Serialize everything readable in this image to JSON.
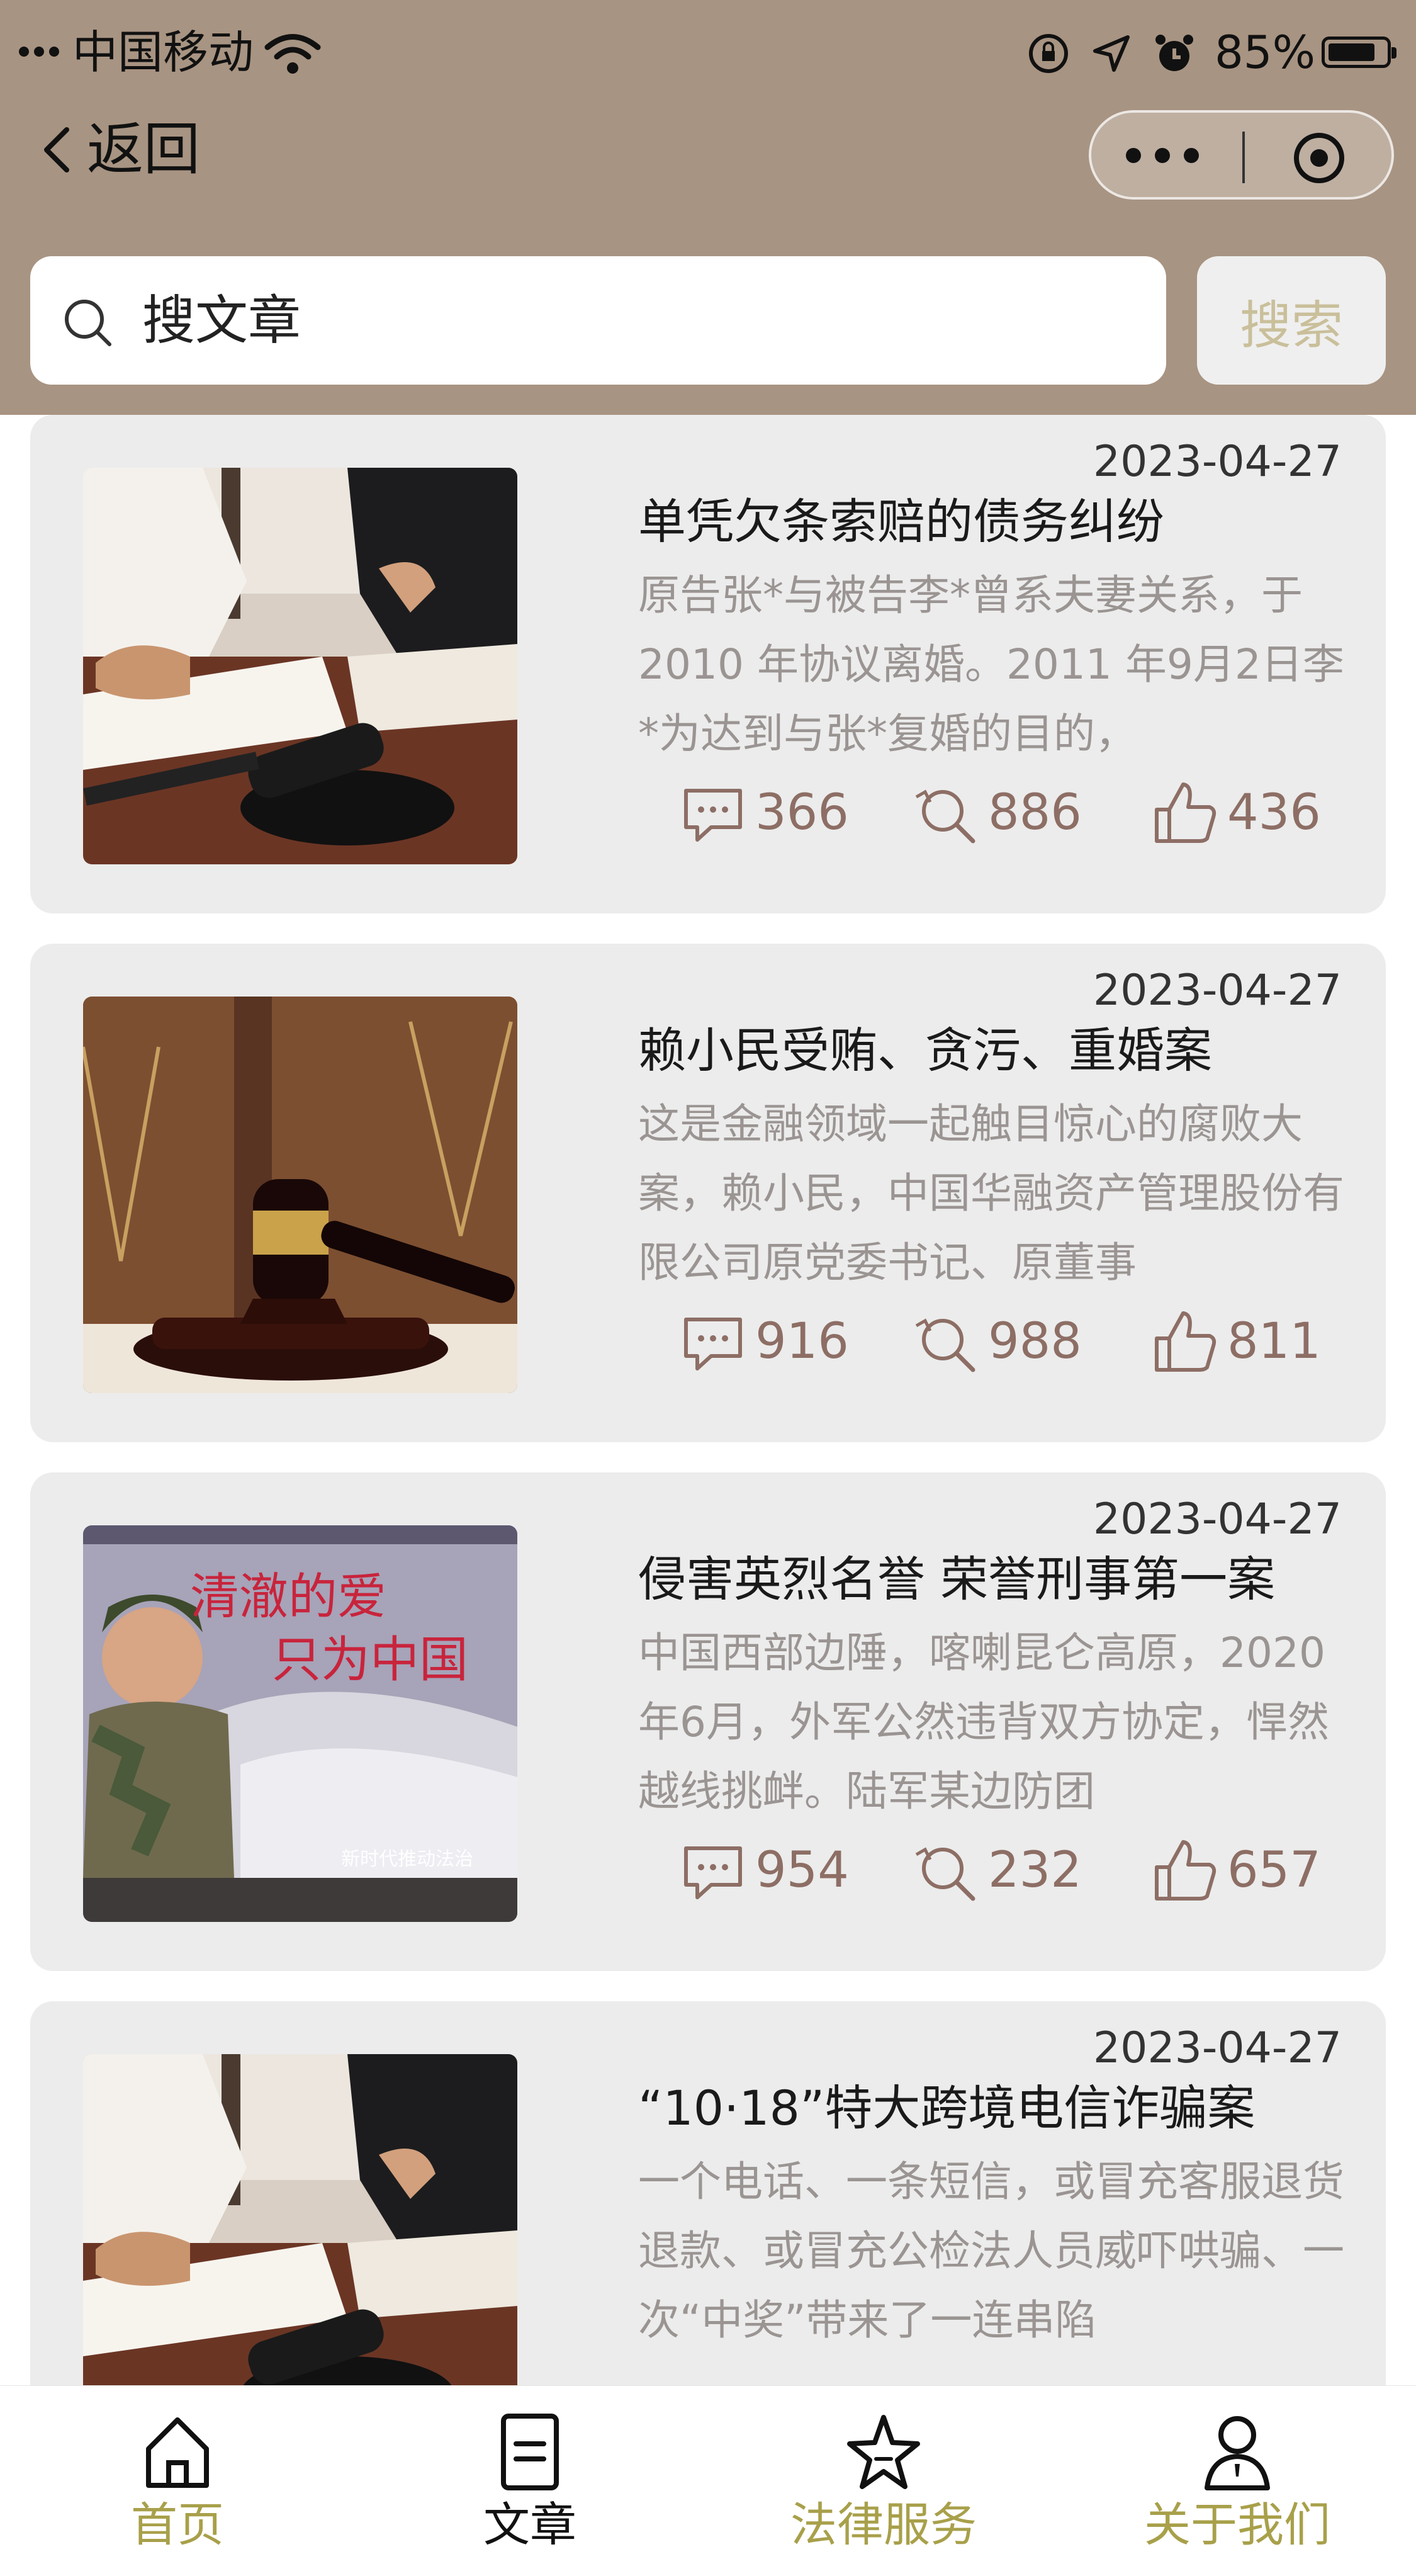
{
  "status_bar": {
    "carrier": "中国移动",
    "battery": "85%",
    "battery_level": 0.85
  },
  "nav": {
    "back_label": "返回"
  },
  "search": {
    "placeholder": "搜文章",
    "button_label": "搜索"
  },
  "articles": [
    {
      "date": "2023-04-27",
      "title": "单凭欠条索赔的债务纠纷",
      "desc": "原告张*与被告李*曾系夫妻关系，于 2010 年协议离婚。2011 年9月2日李*为达到与张*复婚的目的，",
      "comments": "366",
      "views": "886",
      "likes": "436",
      "image": "lawyer-gavel-desk"
    },
    {
      "date": "2023-04-27",
      "title": "赖小民受贿、贪污、重婚案",
      "desc": "这是金融领域一起触目惊心的腐败大案，赖小民，中国华融资产管理股份有限公司原党委书记、原董事",
      "comments": "916",
      "views": "988",
      "likes": "811",
      "image": "gavel-scales"
    },
    {
      "date": "2023-04-27",
      "title": "侵害英烈名誉 荣誉刑事第一案",
      "desc": "中国西部边陲，喀喇昆仑高原，2020年6月，外军公然违背双方协定，悍然越线挑衅。陆军某边防团",
      "comments": "954",
      "views": "232",
      "likes": "657",
      "image": "billboard-soldier",
      "image_text": {
        "line1": "清澈的爱",
        "line2": "只为中国",
        "footer": "新时代推动法治"
      }
    },
    {
      "date": "2023-04-27",
      "title": "“10·18”特大跨境电信诈骗案",
      "desc": "一个电话、一条短信，或冒充客服退货退款、或冒充公检法人员威吓哄骗、一次“中奖”带来了一连串陷",
      "comments": "",
      "views": "",
      "likes": "",
      "image": "lawyer-gavel-desk"
    }
  ],
  "tabbar": {
    "items": [
      {
        "label": "首页",
        "icon": "home-icon",
        "active": false
      },
      {
        "label": "文章",
        "icon": "document-icon",
        "active": true
      },
      {
        "label": "法律服务",
        "icon": "star-icon",
        "active": false
      },
      {
        "label": "关于我们",
        "icon": "person-icon",
        "active": false
      }
    ]
  },
  "colors": {
    "header_bg": "#a89482",
    "card_bg": "#ececec",
    "stat_color": "#8d6e65",
    "tab_inactive": "#a8a04a",
    "tab_active": "#111111"
  }
}
